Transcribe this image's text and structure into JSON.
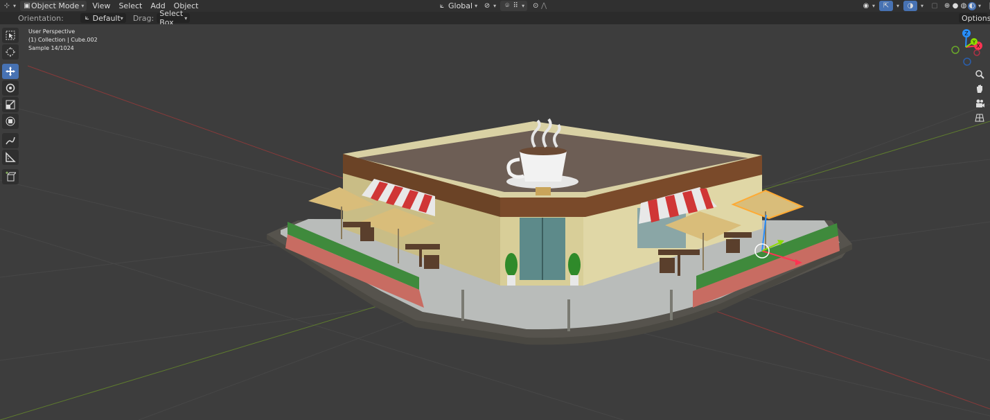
{
  "header": {
    "editor_type_icon": "3d-viewport-icon",
    "mode": "Object Mode",
    "menus": [
      "View",
      "Select",
      "Add",
      "Object"
    ],
    "transform_orientation": "Global",
    "right_icons": [
      "visibility-icon",
      "gizmo-icon",
      "overlay-icon",
      "xray-icon",
      "shading-wire-icon",
      "shading-solid-icon",
      "shading-material-icon",
      "shading-rendered-icon"
    ]
  },
  "tool_settings": {
    "orientation_label": "Orientation:",
    "orientation_value": "Default",
    "drag_label": "Drag:",
    "drag_value": "Select Box",
    "options_label": "Options"
  },
  "viewport": {
    "view_name": "User Perspective",
    "collection_object": "(1) Collection | Cube.002",
    "sample": "Sample 14/1024"
  },
  "tools": [
    "select-box-tool",
    "cursor-tool",
    "move-tool",
    "rotate-tool",
    "scale-tool",
    "transform-tool",
    "annotate-tool",
    "measure-tool",
    "add-cube-tool"
  ],
  "active_tool": "move-tool",
  "gizmo_axes": [
    "X",
    "Y",
    "Z"
  ],
  "colors": {
    "accent": "#4772b3",
    "axis_x": "#ff3352",
    "axis_y": "#8bdc00",
    "axis_z": "#2890ff"
  }
}
